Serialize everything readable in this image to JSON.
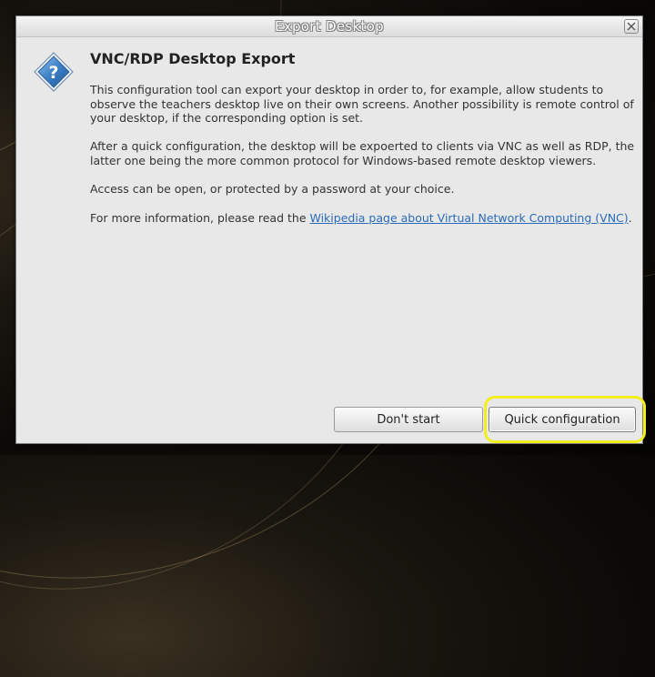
{
  "window": {
    "title": "Export Desktop"
  },
  "icons": {
    "help": "question-icon",
    "close": "close-icon"
  },
  "content": {
    "heading": "VNC/RDP Desktop Export",
    "paragraph1": "This configuration tool can export your desktop in order to, for example, allow students to observe the teachers desktop live on their own screens. Another possibility is remote control of your desktop, if the corresponding option is set.",
    "paragraph2": "After a quick configuration, the desktop will be expoerted to clients via VNC as well as RDP, the latter one being the more common protocol for Windows-based remote desktop viewers.",
    "paragraph3": "Access can be open, or protected by a password at your choice.",
    "paragraph4_prefix": "For more information, please read the ",
    "link_text": "Wikipedia page about Virtual Network Computing (VNC)",
    "paragraph4_suffix": "."
  },
  "buttons": {
    "dont_start": "Don't start",
    "quick_config": "Quick configuration"
  },
  "colors": {
    "link": "#2a6bb8",
    "highlight": "#f2ef1c",
    "icon_blue": "#3b7fc4"
  }
}
